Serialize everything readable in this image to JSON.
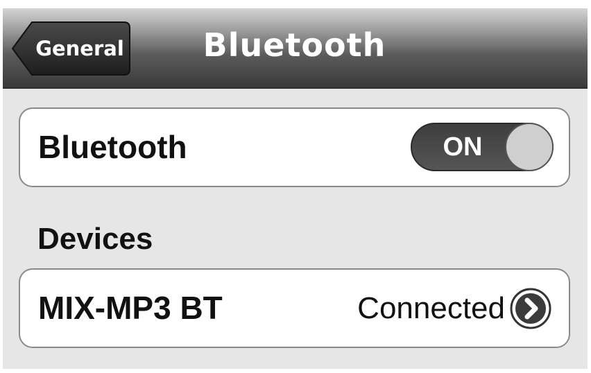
{
  "navbar": {
    "title": "Bluetooth",
    "back_label": "General"
  },
  "bluetooth_row": {
    "label": "Bluetooth",
    "toggle_label": "ON",
    "toggle_on": true
  },
  "devices": {
    "header": "Devices",
    "items": [
      {
        "name": "MIX-MP3 BT",
        "status": "Connected",
        "accessory_icon": "chevron-right-circle-icon"
      }
    ]
  },
  "colors": {
    "navbar_dark": "#3a3a3a",
    "background": "#e6e6e6",
    "group_fill": "#ffffff",
    "toggle_fill": "#4a4a4a",
    "text": "#111111"
  }
}
